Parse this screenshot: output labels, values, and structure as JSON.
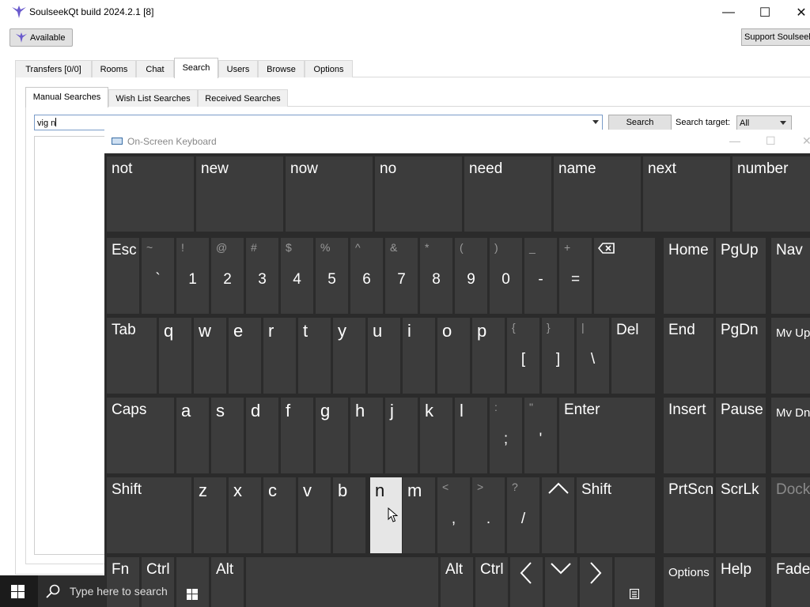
{
  "window": {
    "title": "SoulseekQt build 2024.2.1 [8]",
    "minimize": "—",
    "maximize": "☐",
    "close": "✕"
  },
  "toolbar": {
    "status_label": "Available",
    "support_label": "Support Soulseek"
  },
  "main_tabs": [
    {
      "label": "Transfers [0/0]"
    },
    {
      "label": "Rooms"
    },
    {
      "label": "Chat"
    },
    {
      "label": "Search",
      "active": true
    },
    {
      "label": "Users"
    },
    {
      "label": "Browse"
    },
    {
      "label": "Options"
    }
  ],
  "sub_tabs": [
    {
      "label": "Manual Searches",
      "active": true
    },
    {
      "label": "Wish List Searches"
    },
    {
      "label": "Received Searches"
    }
  ],
  "search": {
    "query": "vig n",
    "button_label": "Search",
    "target_label": "Search target:",
    "target_value": "All"
  },
  "osk": {
    "title": "On-Screen Keyboard",
    "predictions": [
      "not",
      "new",
      "now",
      "no",
      "need",
      "name",
      "next",
      "number"
    ],
    "row1": {
      "esc": "Esc",
      "keys": [
        {
          "shift": "~",
          "primary": "`"
        },
        {
          "shift": "!",
          "primary": "1"
        },
        {
          "shift": "@",
          "primary": "2"
        },
        {
          "shift": "#",
          "primary": "3"
        },
        {
          "shift": "$",
          "primary": "4"
        },
        {
          "shift": "%",
          "primary": "5"
        },
        {
          "shift": "^",
          "primary": "6"
        },
        {
          "shift": "&",
          "primary": "7"
        },
        {
          "shift": "*",
          "primary": "8"
        },
        {
          "shift": "(",
          "primary": "9"
        },
        {
          "shift": ")",
          "primary": "0"
        },
        {
          "shift": "_",
          "primary": "-"
        },
        {
          "shift": "+",
          "primary": "="
        }
      ],
      "nav": [
        "Home",
        "PgUp",
        "Nav"
      ]
    },
    "row2": {
      "tab": "Tab",
      "letters": [
        "q",
        "w",
        "e",
        "r",
        "t",
        "y",
        "u",
        "i",
        "o",
        "p"
      ],
      "symbols": [
        {
          "shift": "{",
          "primary": "["
        },
        {
          "shift": "}",
          "primary": "]"
        },
        {
          "shift": "|",
          "primary": "\\"
        }
      ],
      "del": "Del",
      "nav": [
        "End",
        "PgDn",
        "Mv Up"
      ]
    },
    "row3": {
      "caps": "Caps",
      "letters": [
        "a",
        "s",
        "d",
        "f",
        "g",
        "h",
        "j",
        "k",
        "l"
      ],
      "symbols": [
        {
          "shift": ":",
          "primary": ";"
        },
        {
          "shift": "\"",
          "primary": "'"
        }
      ],
      "enter": "Enter",
      "nav": [
        "Insert",
        "Pause",
        "Mv Dn"
      ]
    },
    "row4": {
      "shift_left": "Shift",
      "letters": [
        "z",
        "x",
        "c",
        "v",
        "b",
        "n",
        "m"
      ],
      "symbols": [
        {
          "shift": "<",
          "primary": ","
        },
        {
          "shift": ">",
          "primary": "."
        },
        {
          "shift": "?",
          "primary": "/"
        }
      ],
      "shift_right": "Shift",
      "nav": [
        "PrtScn",
        "ScrLk",
        "Dock"
      ],
      "pressed": "n"
    },
    "row5": {
      "fn": "Fn",
      "ctrl_left": "Ctrl",
      "alt_left": "Alt",
      "alt_right": "Alt",
      "ctrl_right": "Ctrl",
      "options": "Options",
      "help": "Help",
      "fade": "Fade"
    }
  },
  "taskbar": {
    "search_placeholder": "Type here to search"
  },
  "colors": {
    "osk_background": "#2b2b2b",
    "key": "#3c3c3c",
    "key_pressed": "#e6e6e6",
    "logo": "#6a5acd"
  }
}
